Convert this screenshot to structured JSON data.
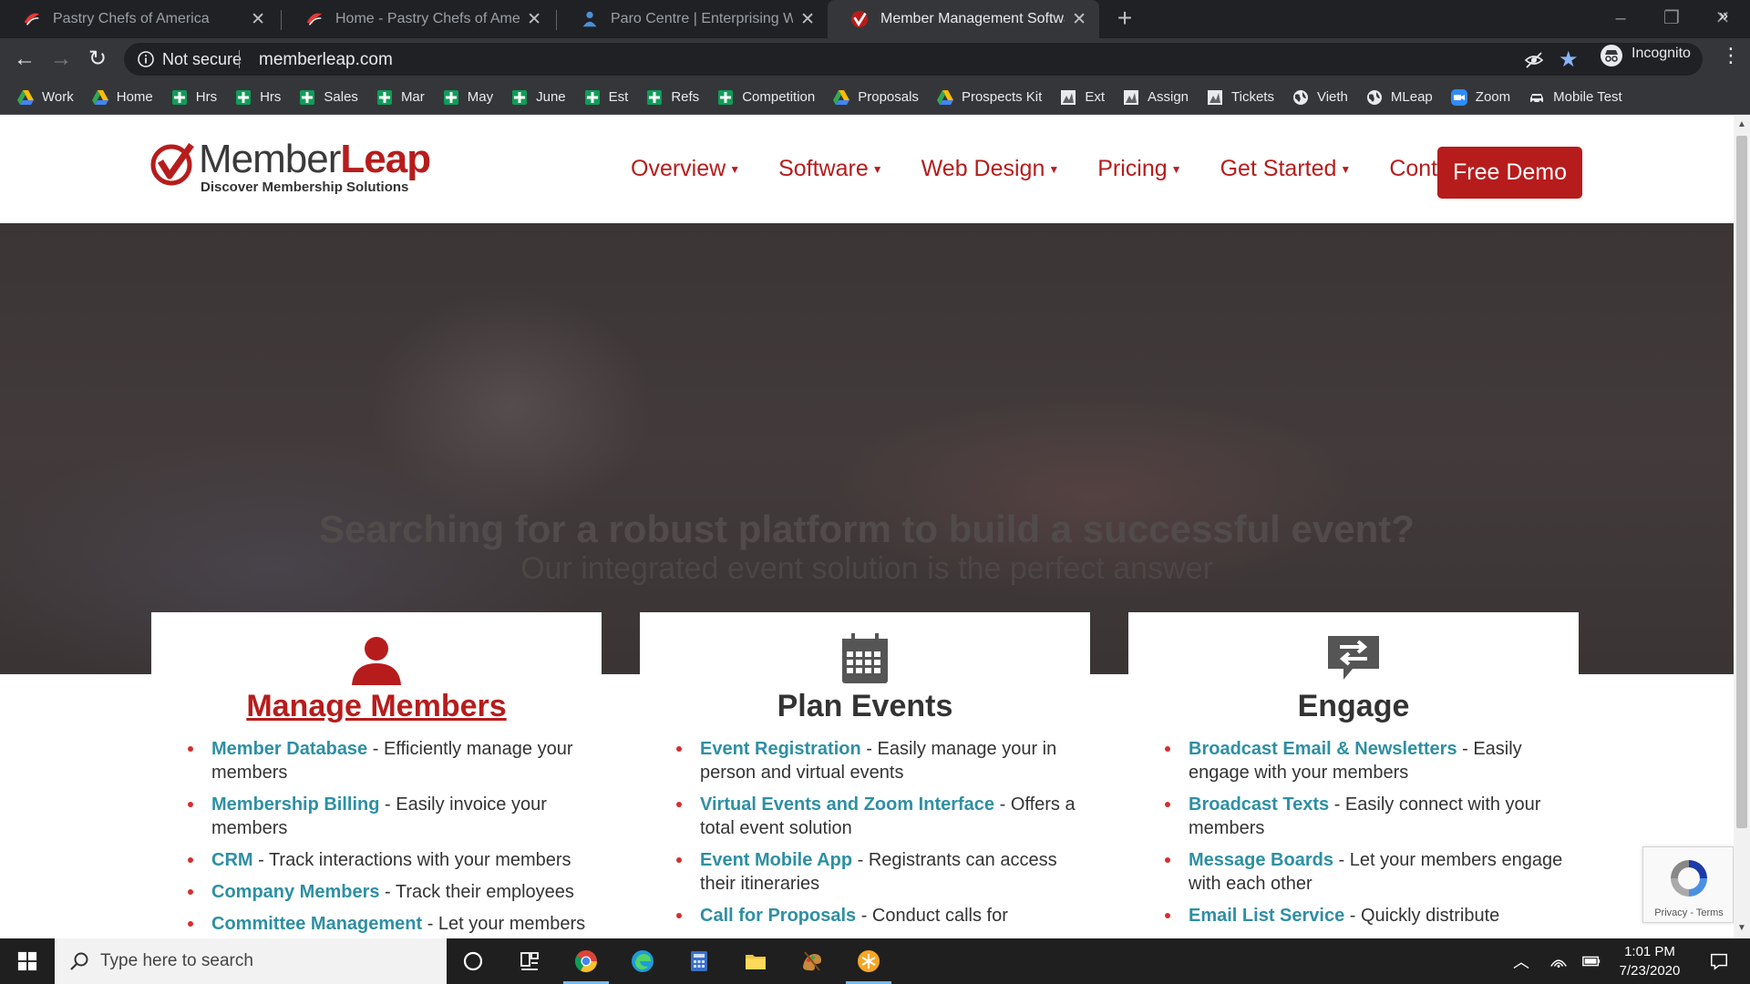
{
  "browser": {
    "tabs": [
      {
        "title": "Pastry Chefs of America",
        "active": false
      },
      {
        "title": "Home - Pastry Chefs of America",
        "active": false
      },
      {
        "title": "Paro Centre | Enterprising Women",
        "active": false
      },
      {
        "title": "Member Management Software",
        "active": true
      }
    ],
    "address": {
      "security": "Not secure",
      "url": "memberleap.com"
    },
    "profile": "Incognito",
    "bookmarks": [
      {
        "label": "Work",
        "icon": "drive-icon"
      },
      {
        "label": "Home",
        "icon": "drive-icon"
      },
      {
        "label": "Hrs",
        "icon": "sheets-icon"
      },
      {
        "label": "Hrs",
        "icon": "sheets-icon"
      },
      {
        "label": "Sales",
        "icon": "sheets-icon"
      },
      {
        "label": "Mar",
        "icon": "sheets-icon"
      },
      {
        "label": "May",
        "icon": "sheets-icon"
      },
      {
        "label": "June",
        "icon": "sheets-icon"
      },
      {
        "label": "Est",
        "icon": "sheets-icon"
      },
      {
        "label": "Refs",
        "icon": "sheets-icon"
      },
      {
        "label": "Competition",
        "icon": "sheets-icon"
      },
      {
        "label": "Proposals",
        "icon": "drive-icon"
      },
      {
        "label": "Prospects Kit",
        "icon": "drive-icon"
      },
      {
        "label": "Ext",
        "icon": "form-icon"
      },
      {
        "label": "Assign",
        "icon": "form-icon"
      },
      {
        "label": "Tickets",
        "icon": "form-icon"
      },
      {
        "label": "Vieth",
        "icon": "globe-icon"
      },
      {
        "label": "MLeap",
        "icon": "globe-icon"
      },
      {
        "label": "Zoom",
        "icon": "zoom-icon"
      },
      {
        "label": "Mobile Test",
        "icon": "car-icon"
      }
    ],
    "bookmarks_more": "»"
  },
  "site": {
    "logo": {
      "word1": "Member",
      "word2": "Leap",
      "tagline": "Discover Membership Solutions"
    },
    "nav": [
      {
        "label": "Overview",
        "caret": true
      },
      {
        "label": "Software",
        "caret": true
      },
      {
        "label": "Web Design",
        "caret": true
      },
      {
        "label": "Pricing",
        "caret": true
      },
      {
        "label": "Get Started",
        "caret": true
      },
      {
        "label": "Contact",
        "caret": false
      }
    ],
    "cta": "Free Demo",
    "hero": {
      "title": "Searching for a robust platform to build a successful event?",
      "subtitle": "Our integrated event solution is the perfect answer"
    },
    "cards": [
      {
        "icon": "person-icon",
        "title": "Manage Members",
        "items": [
          {
            "term": "Member Database",
            "desc": " - Efficiently manage your members"
          },
          {
            "term": "Membership Billing",
            "desc": " - Easily invoice your members"
          },
          {
            "term": "CRM",
            "desc": " - Track interactions with your members"
          },
          {
            "term": "Company Members",
            "desc": " - Track their employees"
          },
          {
            "term": "Committee Management",
            "desc": " - Let your members"
          }
        ]
      },
      {
        "icon": "calendar-icon",
        "title": "Plan Events",
        "items": [
          {
            "term": "Event Registration",
            "desc": " - Easily manage your in person and virtual events"
          },
          {
            "term": "Virtual Events and Zoom Interface",
            "desc": " - Offers a total event solution"
          },
          {
            "term": "Event Mobile App",
            "desc": " - Registrants can access their itineraries"
          },
          {
            "term": "Call for Proposals",
            "desc": " - Conduct calls for"
          }
        ]
      },
      {
        "icon": "chat-exchange-icon",
        "title": "Engage",
        "items": [
          {
            "term": "Broadcast Email & Newsletters",
            "desc": " - Easily engage with your members"
          },
          {
            "term": "Broadcast Texts",
            "desc": " - Easily connect with your members"
          },
          {
            "term": "Message Boards",
            "desc": " - Let your members engage with each other"
          },
          {
            "term": "Email List Service",
            "desc": " - Quickly distribute"
          }
        ]
      }
    ],
    "recaptcha": "Privacy - Terms"
  },
  "taskbar": {
    "search_placeholder": "Type here to search",
    "time": "1:01 PM",
    "date": "7/23/2020"
  },
  "colors": {
    "brand_red": "#b71c1c",
    "link_teal": "#2e8fa3",
    "chrome_dark": "#202124",
    "chrome_mid": "#35363a"
  }
}
